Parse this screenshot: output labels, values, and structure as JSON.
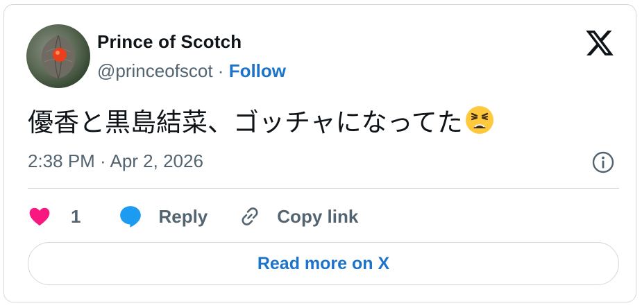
{
  "author": {
    "name": "Prince of Scotch",
    "handle": "@princeofscot",
    "separator": " · ",
    "follow_label": "Follow"
  },
  "tweet": {
    "text": "優香と黒島結菜、ゴッチャになってた",
    "emoji": "weary-face-emoji",
    "timestamp": "2:38 PM · Apr 2, 2026"
  },
  "actions": {
    "like_count": "1",
    "reply_label": "Reply",
    "copy_label": "Copy link"
  },
  "read_more_label": "Read more on X",
  "icons": [
    "x-logo-icon",
    "info-icon",
    "heart-icon",
    "reply-bubble-icon",
    "link-icon"
  ],
  "colors": {
    "accent": "#1d73c9",
    "like": "#f91880",
    "reply": "#1d9bf0",
    "muted": "#536471",
    "border": "#cfd9de"
  }
}
